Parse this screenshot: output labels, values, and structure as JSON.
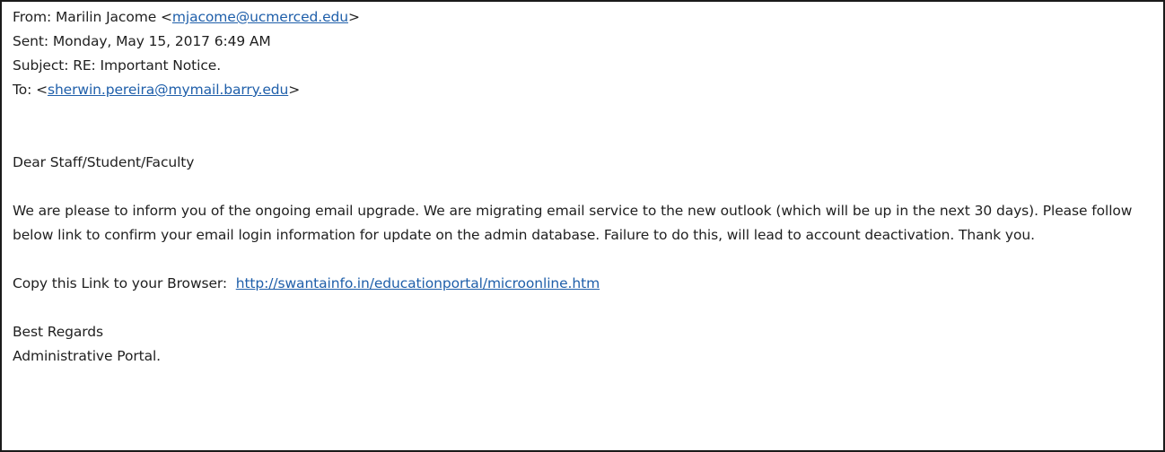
{
  "header": {
    "from_label": "From: Marilin Jacome <",
    "from_email": "mjacome@ucmerced.edu",
    "from_close": ">",
    "sent": "Sent: Monday, May 15, 2017 6:49 AM",
    "subject": "Subject: RE: Important Notice.",
    "to_label": "To: <",
    "to_email": "sherwin.pereira@mymail.barry.edu",
    "to_close": ">"
  },
  "body": {
    "greeting": "Dear Staff/Student/Faculty",
    "paragraph": "We are please to inform you of the ongoing email upgrade. We are migrating email service to the new outlook (which will be up in the next 30 days). Please follow below link to confirm your email login information for update on the admin database. Failure to do this, will lead to account deactivation. Thank you.",
    "link_prefix": "Copy this Link to your Browser:  ",
    "link_url": "http://swantainfo.in/educationportal/microonline.htm",
    "closing": "Best Regards",
    "signature": "Administrative Portal."
  },
  "colors": {
    "link": "#1f5faa",
    "text": "#1f1f1f",
    "border": "#1a1a1a"
  }
}
